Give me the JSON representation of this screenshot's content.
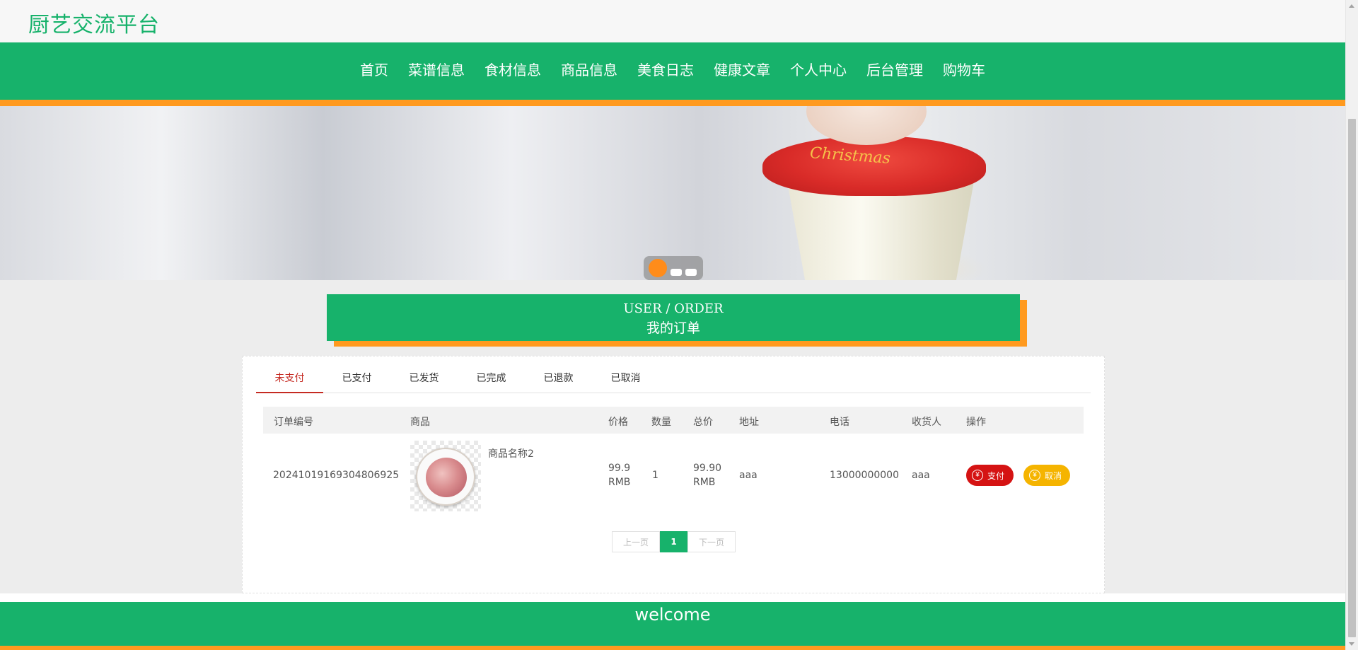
{
  "brand": {
    "title": "厨艺交流平台"
  },
  "nav": {
    "items": [
      "首页",
      "菜谱信息",
      "食材信息",
      "商品信息",
      "美食日志",
      "健康文章",
      "个人中心",
      "后台管理",
      "购物车"
    ]
  },
  "banner": {
    "cup_text": "Christmas",
    "carousel": {
      "slide_count": 3,
      "active_index": 0
    }
  },
  "section": {
    "title_en": "USER / ORDER",
    "title_zh": "我的订单"
  },
  "tabs": [
    "未支付",
    "已支付",
    "已发货",
    "已完成",
    "已退款",
    "已取消"
  ],
  "table": {
    "headers": [
      "订单编号",
      "商品",
      "价格",
      "数量",
      "总价",
      "地址",
      "电话",
      "收货人",
      "操作"
    ],
    "rows": [
      {
        "order_no": "20241019169304806925⁠",
        "product_name": "商品名称2",
        "price": "99.9",
        "price_unit": "RMB",
        "qty": "1",
        "total": "99.90",
        "total_unit": "RMB",
        "address": "aaa",
        "phone": "13000000000",
        "receiver": "aaa"
      }
    ],
    "actions": {
      "pay": "支付",
      "cancel": "取消",
      "icon_glyph": "¥"
    }
  },
  "pager": {
    "prev": "上一页",
    "current": "1",
    "next": "下一页"
  },
  "footer": {
    "text": "welcome"
  },
  "colors": {
    "primary": "#17b26b",
    "accent": "#ff9a1f",
    "danger": "#d51313",
    "warning": "#f5b400",
    "active_tab": "#c52a22"
  }
}
